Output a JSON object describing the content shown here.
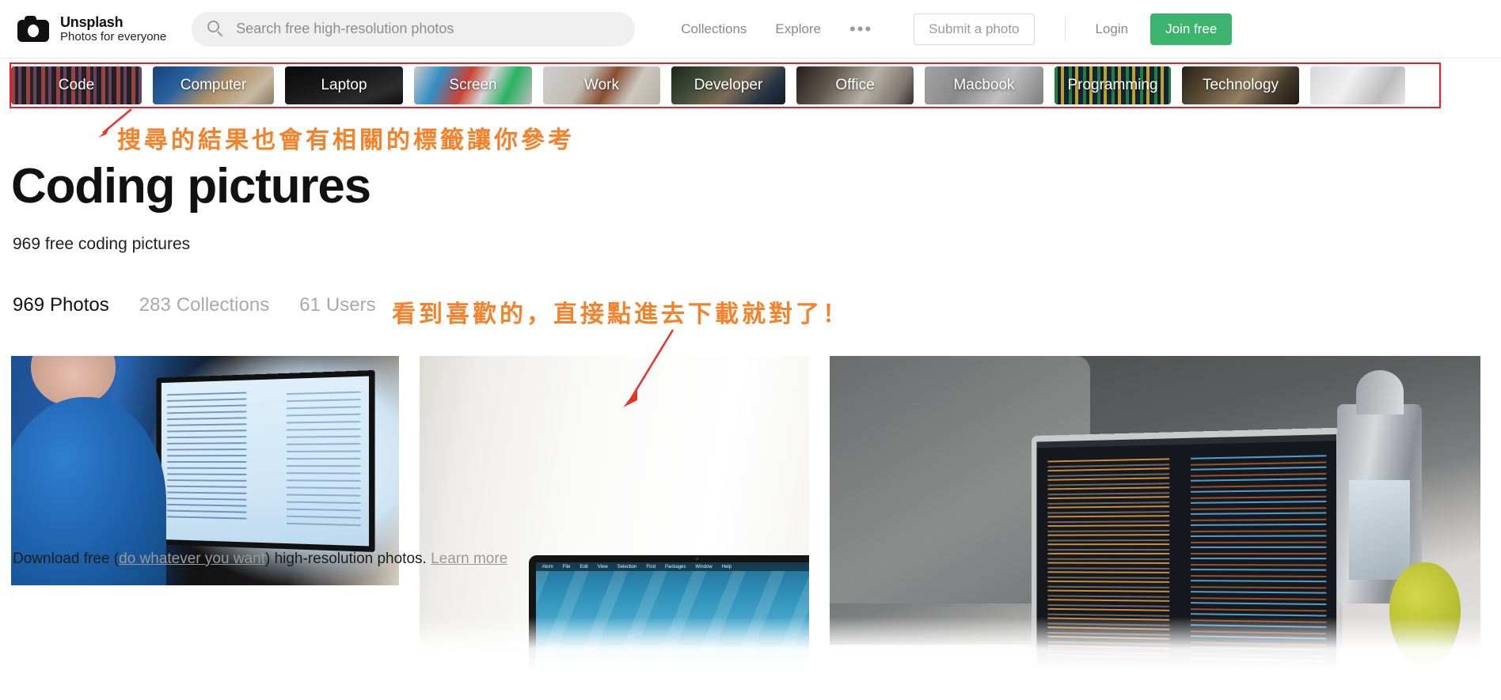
{
  "header": {
    "brand_name": "Unsplash",
    "brand_tagline": "Photos for everyone",
    "logo_icon": "camera-icon",
    "search": {
      "icon": "search-icon",
      "placeholder": "Search free high-resolution photos",
      "value": ""
    },
    "nav": [
      {
        "label": "Collections"
      },
      {
        "label": "Explore"
      }
    ],
    "more_icon": "ellipsis-icon",
    "more_label": "•••",
    "submit_label": "Submit a photo",
    "login_label": "Login",
    "join_label": "Join free",
    "join_color": "#3cb46e"
  },
  "tags": [
    {
      "label": "Code",
      "thumb": "t-code"
    },
    {
      "label": "Computer",
      "thumb": "t-computer"
    },
    {
      "label": "Laptop",
      "thumb": "t-laptop"
    },
    {
      "label": "Screen",
      "thumb": "t-screen"
    },
    {
      "label": "Work",
      "thumb": "t-work"
    },
    {
      "label": "Developer",
      "thumb": "t-developer"
    },
    {
      "label": "Office",
      "thumb": "t-office"
    },
    {
      "label": "Macbook",
      "thumb": "t-macbook"
    },
    {
      "label": "Programming",
      "thumb": "t-programming"
    },
    {
      "label": "Technology",
      "thumb": "t-technology"
    },
    {
      "label": "",
      "thumb": "t-extra"
    }
  ],
  "annotations": {
    "color": "#f5812a",
    "box_color": "#ee1c24",
    "note_1": "搜尋的結果也會有相關的標籤讓你參考",
    "note_2": "看到喜歡的，直接點進去下載就對了！"
  },
  "main": {
    "title": "Coding pictures",
    "subtitle": "969 free coding pictures",
    "counts": [
      {
        "num": "969",
        "label": "Photos",
        "active": true
      },
      {
        "num": "283",
        "label": "Collections",
        "active": false
      },
      {
        "num": "61",
        "label": "Users",
        "active": false
      }
    ]
  },
  "photos": [
    {
      "alt": "person in blue shirt coding on an iMac"
    },
    {
      "alt": "black macbook on a bright white desk"
    },
    {
      "alt": "macbook with code on table beside lantern and green apple"
    }
  ],
  "footer": {
    "text_before": "Download free (",
    "link_1": "do whatever you want",
    "text_middle": ") high-resolution photos. ",
    "link_2": "Learn more"
  }
}
